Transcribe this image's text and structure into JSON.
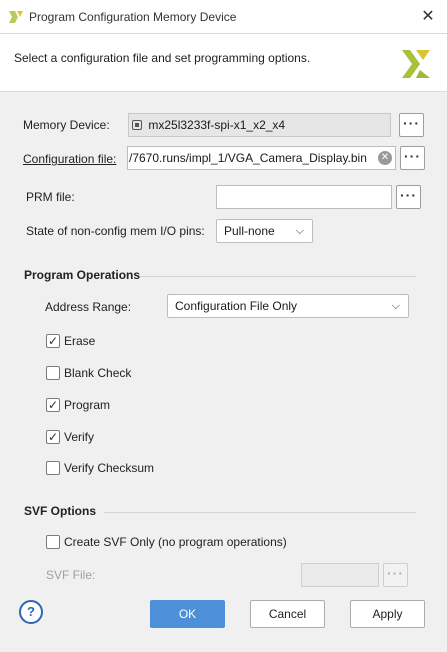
{
  "window": {
    "title": "Program Configuration Memory Device",
    "close_glyph": "✕",
    "icon": "xilinx-logo-icon"
  },
  "header": {
    "description": "Select a configuration file and set programming options."
  },
  "form": {
    "memory_device": {
      "label": "Memory Device:",
      "value": "mx25l3233f-spi-x1_x2_x4",
      "icon": "chip-icon"
    },
    "config_file": {
      "label": "Configuration file:",
      "value": "/7670.runs/impl_1/VGA_Camera_Display.bin"
    },
    "prm_file": {
      "label": "PRM file:",
      "value": ""
    },
    "io_pins": {
      "label": "State of non-config mem I/O pins:",
      "value": "Pull-none"
    },
    "browse_glyph": "···"
  },
  "program_operations": {
    "title": "Program Operations",
    "address_range": {
      "label": "Address Range:",
      "value": "Configuration File Only"
    },
    "options": [
      {
        "label": "Erase",
        "checked": true
      },
      {
        "label": "Blank Check",
        "checked": false
      },
      {
        "label": "Program",
        "checked": true
      },
      {
        "label": "Verify",
        "checked": true
      },
      {
        "label": "Verify Checksum",
        "checked": false
      }
    ]
  },
  "svf_options": {
    "title": "SVF Options",
    "create_svf": {
      "label": "Create SVF Only (no program operations)",
      "checked": false
    },
    "svf_file": {
      "label": "SVF File:",
      "value": ""
    }
  },
  "buttons": {
    "help": "?",
    "ok": "OK",
    "cancel": "Cancel",
    "apply": "Apply"
  },
  "colors": {
    "primary_button": "#4d8fd9",
    "help_icon": "#2b66b4",
    "logo": "#a6c23a"
  }
}
